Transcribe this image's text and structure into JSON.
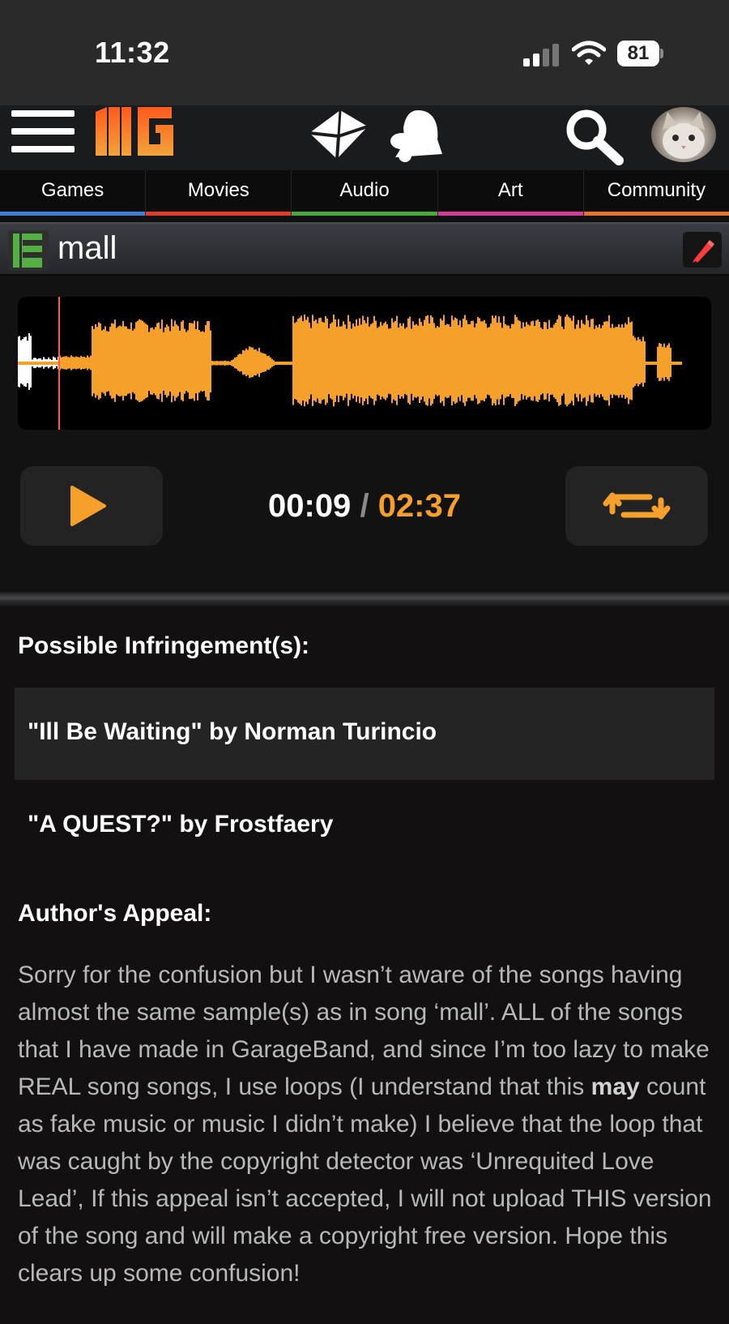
{
  "status_bar": {
    "time": "11:32",
    "battery": "81",
    "icons": [
      "cellular-signal-icon",
      "wifi-icon",
      "battery-icon"
    ]
  },
  "header": {
    "logo_text": "NG",
    "icons": [
      "hamburger-menu-icon",
      "mail-icon",
      "bell-icon",
      "search-icon",
      "avatar"
    ]
  },
  "nav": {
    "tabs": [
      {
        "label": "Games",
        "color": "#3d7fd6"
      },
      {
        "label": "Movies",
        "color": "#e03b2d"
      },
      {
        "label": "Audio",
        "color": "#48a83c"
      },
      {
        "label": "Art",
        "color": "#d63a9a"
      },
      {
        "label": "Community",
        "color": "#e8742c"
      }
    ]
  },
  "song": {
    "genre_letter": "E",
    "title": "mall"
  },
  "player": {
    "current_time": "00:09",
    "separator": "/",
    "duration": "02:37",
    "progress": 0.06,
    "accent": "#f6a02c"
  },
  "infringements": {
    "heading": "Possible Infringement(s):",
    "items": [
      "\"Ill Be Waiting\" by Norman Turincio",
      "\"A QUEST?\" by Frostfaery"
    ]
  },
  "appeal": {
    "heading": "Author's Appeal:",
    "text_before": "Sorry for the confusion but I wasn’t aware of the songs having almost the same sample(s) as in song ‘mall’. ALL of the songs that I have made in GarageBand, and since I’m too lazy to make REAL song songs, I use loops (I understand that this ",
    "emphasis": "may",
    "text_after": " count as fake music or music I didn’t make) I believe that the loop that was caught by the copyright detector was ‘Unrequited Love Lead’, If this appeal isn’t accepted, I will not upload THIS version of the song and will make a copyright free version. Hope this clears up some confusion!"
  }
}
